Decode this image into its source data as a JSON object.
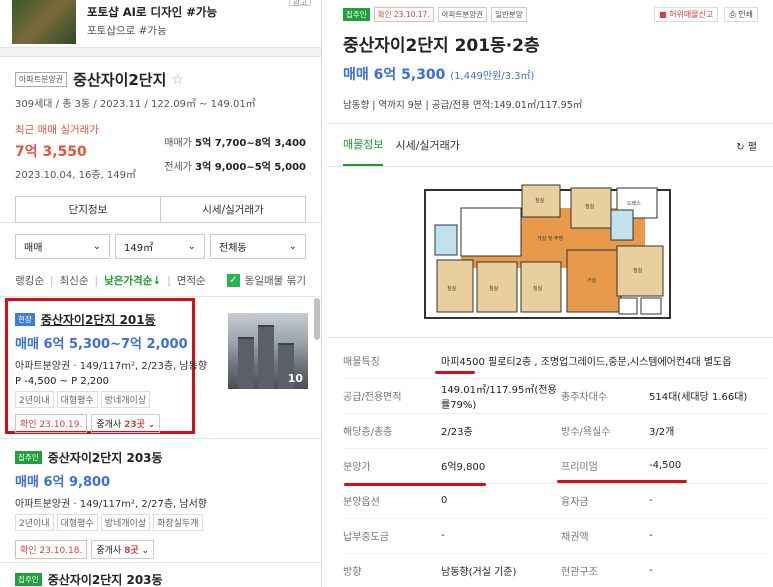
{
  "ad": {
    "title": "포토샵 AI로 디자인 #가능",
    "subtitle": "포토샵으로 #가능",
    "close": "광고"
  },
  "complex": {
    "tag": "아파트분양권",
    "name": "중산자이2단지",
    "star": "☆",
    "meta": "309세대 / 총 3동 / 2023.11 / 122.09㎡ ~ 149.01㎡",
    "recent_label": "최근 매매 실거래가",
    "recent_price": "7억 3,550",
    "recent_date": "2023.10.04, 16층, 149㎡",
    "sale_label": "매매가",
    "sale_range": "5억 7,700~8억 3,400",
    "jeonse_label": "전세가",
    "jeonse_range": "3억 9,000~5억 5,000",
    "btn_info": "단지정보",
    "btn_price": "시세/실거래가"
  },
  "filters": {
    "type": "매매",
    "area": "149㎡",
    "dong": "전체동"
  },
  "sort": {
    "options": [
      "랭킹순",
      "최신순",
      "낮은가격순↓",
      "면적순"
    ],
    "same": "동일매물 묶기",
    "check": "✓"
  },
  "listings": [
    {
      "badge": "현장",
      "name": "중산자이2단지 201동",
      "price": "매매 6억 5,300~7억 2,000",
      "spec": "아파트분양권 · 149/117m², 2/23층, 남동향",
      "pm": "P -4,500 ~ P 2,200",
      "tags": [
        "2년이내",
        "대형평수",
        "방네개이상"
      ],
      "confirm": "확인 23.10.19.",
      "agents_prefix": "중개사 ",
      "agents_count": "23곳",
      "photo_count": "10"
    },
    {
      "badge": "집주인",
      "name": "중산자이2단지 203동",
      "price": "매매 6억 9,800",
      "spec": "아파트분양권 · 149/117m², 2/27층, 남서향",
      "tags": [
        "2년이내",
        "대형평수",
        "방네개이상",
        "화장실두개"
      ],
      "confirm": "확인 23.10.18.",
      "agents_prefix": "중개사 ",
      "agents_count": "8곳"
    },
    {
      "badge": "집주인",
      "name": "중산자이2단지 203동"
    }
  ],
  "detail": {
    "badges": [
      "집주인",
      "확인 23.10.17.",
      "아파트분양권",
      "일반분양"
    ],
    "report": "허위매물신고",
    "print": "인쇄",
    "title": "중산자이2단지 201동·2층",
    "price": "매매 6억 5,300",
    "price_unit": "(1,449만원/3.3㎡)",
    "meta": "남동향 | 역까지 9분 | 공급/전용 면적:149.01㎡/117.95㎡",
    "tabs": [
      "매물정보",
      "시세/실거래가"
    ],
    "refresh": "↻ 펼",
    "rows": [
      {
        "k": "매물특징",
        "v": "마피4500 필로티2층 , 조명업그레이드,중문,시스템에어컨4대 별도옵",
        "wide": true
      },
      {
        "k": "공급/전용면적",
        "v": "149.01㎡/117.95㎡(전용률79%)",
        "k2": "총주차대수",
        "v2": "514대(세대당 1.66대)"
      },
      {
        "k": "해당층/총층",
        "v": "2/23층",
        "k2": "방수/욕실수",
        "v2": "3/2개"
      },
      {
        "k": "분양가",
        "v": "6억9,800",
        "k2": "프리미엄",
        "v2": "-4,500"
      },
      {
        "k": "분양옵션",
        "v": "0",
        "k2": "융자금",
        "v2": "-"
      },
      {
        "k": "납부중도금",
        "v": "-",
        "k2": "채권액",
        "v2": "-"
      },
      {
        "k": "방향",
        "v": "남동향(거실 기준)",
        "k2": "현관구조",
        "v2": "-"
      }
    ]
  },
  "colors": {
    "accent_green": "#19a02b",
    "price_blue": "#3b6fd8",
    "alert_red": "#d40f18"
  }
}
